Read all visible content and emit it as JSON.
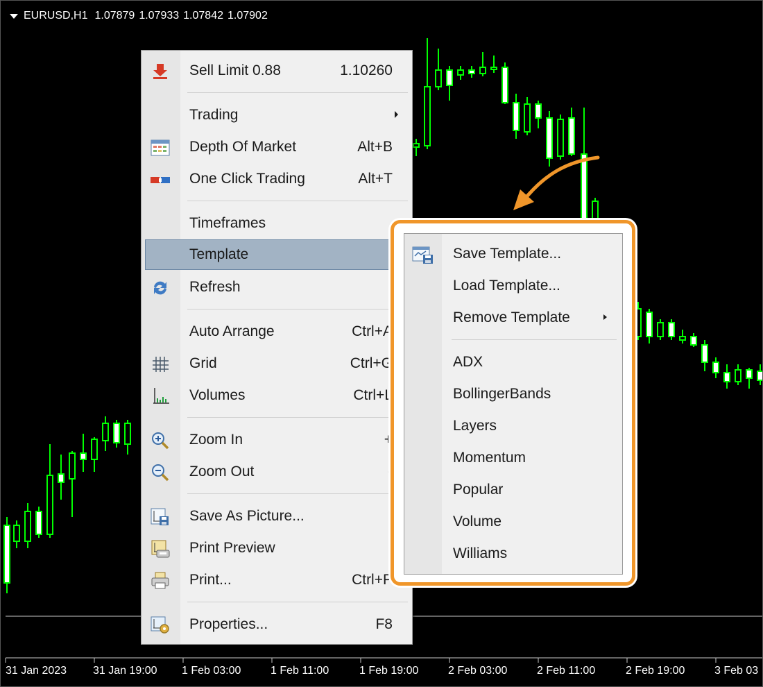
{
  "chart": {
    "symbol": "EURUSD,H1",
    "open": "1.07879",
    "high": "1.07933",
    "low": "1.07842",
    "close": "1.07902",
    "colors": {
      "background": "#000000",
      "bull": "#00ff00",
      "bear": "#00ff00",
      "body_fill_bull": "#000000",
      "body_fill_bear": "#ffffff"
    },
    "x_axis_labels": [
      "31 Jan 2023",
      "31 Jan 19:00",
      "1 Feb 03:00",
      "1 Feb 11:00",
      "1 Feb 19:00",
      "2 Feb 03:00",
      "2 Feb 11:00",
      "2 Feb 19:00",
      "3 Feb 03"
    ]
  },
  "context_menu": {
    "sell_limit": {
      "label": "Sell Limit 0.88",
      "value": "1.10260",
      "icon": "sell-arrow-icon"
    },
    "trading": {
      "label": "Trading",
      "has_submenu": true
    },
    "depth_of_market": {
      "label": "Depth Of Market",
      "shortcut": "Alt+B",
      "icon": "depth-of-market-icon"
    },
    "one_click_trading": {
      "label": "One Click Trading",
      "shortcut": "Alt+T",
      "icon": "one-click-trading-icon"
    },
    "timeframes": {
      "label": "Timeframes",
      "has_submenu": true
    },
    "template": {
      "label": "Template",
      "has_submenu": true,
      "highlighted": true
    },
    "refresh": {
      "label": "Refresh",
      "icon": "refresh-icon"
    },
    "auto_arrange": {
      "label": "Auto Arrange",
      "shortcut": "Ctrl+A"
    },
    "grid": {
      "label": "Grid",
      "shortcut": "Ctrl+G",
      "icon": "grid-icon"
    },
    "volumes": {
      "label": "Volumes",
      "shortcut": "Ctrl+L",
      "icon": "volumes-icon"
    },
    "zoom_in": {
      "label": "Zoom In",
      "shortcut": "+",
      "icon": "zoom-in-icon"
    },
    "zoom_out": {
      "label": "Zoom Out",
      "shortcut": "-",
      "icon": "zoom-out-icon"
    },
    "save_as_picture": {
      "label": "Save As Picture...",
      "icon": "save-picture-icon"
    },
    "print_preview": {
      "label": "Print Preview",
      "icon": "print-preview-icon"
    },
    "print": {
      "label": "Print...",
      "shortcut": "Ctrl+P",
      "icon": "printer-icon"
    },
    "properties": {
      "label": "Properties...",
      "shortcut": "F8",
      "icon": "properties-icon"
    }
  },
  "template_submenu": {
    "save_template": {
      "label": "Save Template...",
      "icon": "save-template-icon"
    },
    "load_template": {
      "label": "Load Template..."
    },
    "remove_template": {
      "label": "Remove Template",
      "has_submenu": true
    },
    "templates": [
      "ADX",
      "BollingerBands",
      "Layers",
      "Momentum",
      "Popular",
      "Volume",
      "Williams"
    ],
    "highlight_color": "#f0962a"
  }
}
